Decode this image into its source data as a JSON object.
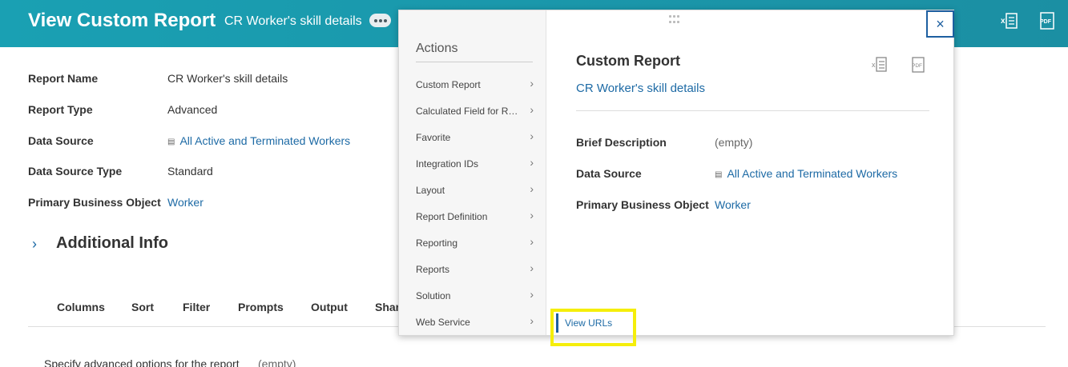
{
  "header": {
    "title": "View Custom Report",
    "subtitle": "CR Worker's skill details",
    "excel_icon": "export-to-excel-icon",
    "pdf_icon": "export-to-pdf-icon",
    "related_actions_icon": "related-actions-icon"
  },
  "fields": [
    {
      "label": "Report Name",
      "value": "CR Worker's skill details"
    },
    {
      "label": "Report Type",
      "value": "Advanced"
    },
    {
      "label": "Data Source",
      "value": "All Active and Terminated Workers"
    },
    {
      "label": "Data Source Type",
      "value": "Standard"
    },
    {
      "label": "Primary Business Object",
      "value": "Worker"
    }
  ],
  "additional_info": {
    "title": "Additional Info"
  },
  "tabs": [
    "Columns",
    "Sort",
    "Filter",
    "Prompts",
    "Output",
    "Shar"
  ],
  "bottom": {
    "label": "Specify advanced options for the report",
    "value": "(empty)"
  },
  "popup": {
    "menu_heading": "Actions",
    "menu_items": [
      "Custom Report",
      "Calculated Field for Re...",
      "Favorite",
      "Integration IDs",
      "Layout",
      "Report Definition",
      "Reporting",
      "Reports",
      "Solution",
      "Web Service"
    ],
    "submenu_item": "View URLs",
    "detail_title": "Custom Report",
    "detail_link": "CR Worker's skill details",
    "details": [
      {
        "label": "Brief Description",
        "value": "(empty)"
      },
      {
        "label": "Data Source",
        "value": "All Active and Terminated Workers"
      },
      {
        "label": "Primary Business Object",
        "value": "Worker"
      }
    ],
    "close_label": "×"
  },
  "colors": {
    "header": "#1b98ab",
    "link": "#1d6aa5",
    "highlight": "#f5ee0a"
  }
}
